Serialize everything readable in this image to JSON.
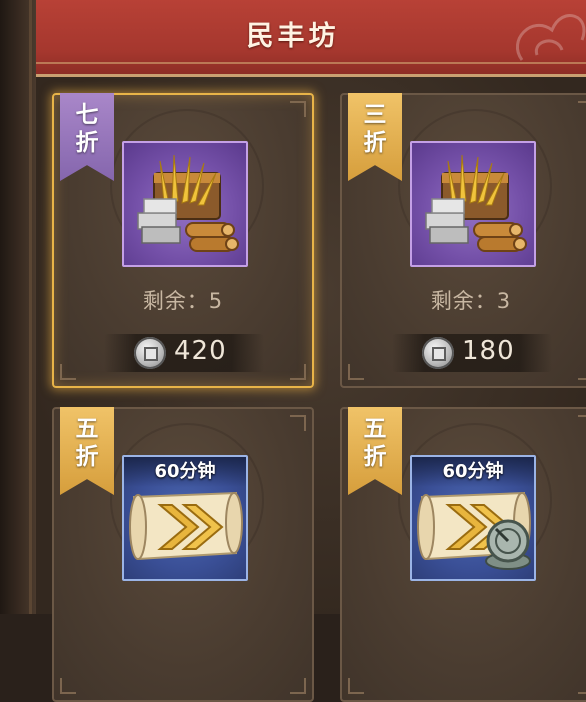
{
  "header": {
    "title": "民丰坊"
  },
  "cards": [
    {
      "discount": "七折",
      "remaining": "剩余：5",
      "price": "420",
      "item": "resource-chest-icon"
    },
    {
      "discount": "三折",
      "remaining": "剩余：3",
      "price": "180",
      "item": "resource-chest-icon"
    },
    {
      "discount": "五折",
      "duration": "60分钟",
      "item": "speedup-scroll-icon"
    },
    {
      "discount": "五折",
      "duration": "60分钟",
      "item": "speedup-scroll-sundial-icon"
    }
  ],
  "colors": {
    "title_bar": "#a5372e",
    "selected_border": "#e8b448",
    "purple_ribbon": "#9a7bbe",
    "gold_ribbon": "#e0aa48"
  }
}
